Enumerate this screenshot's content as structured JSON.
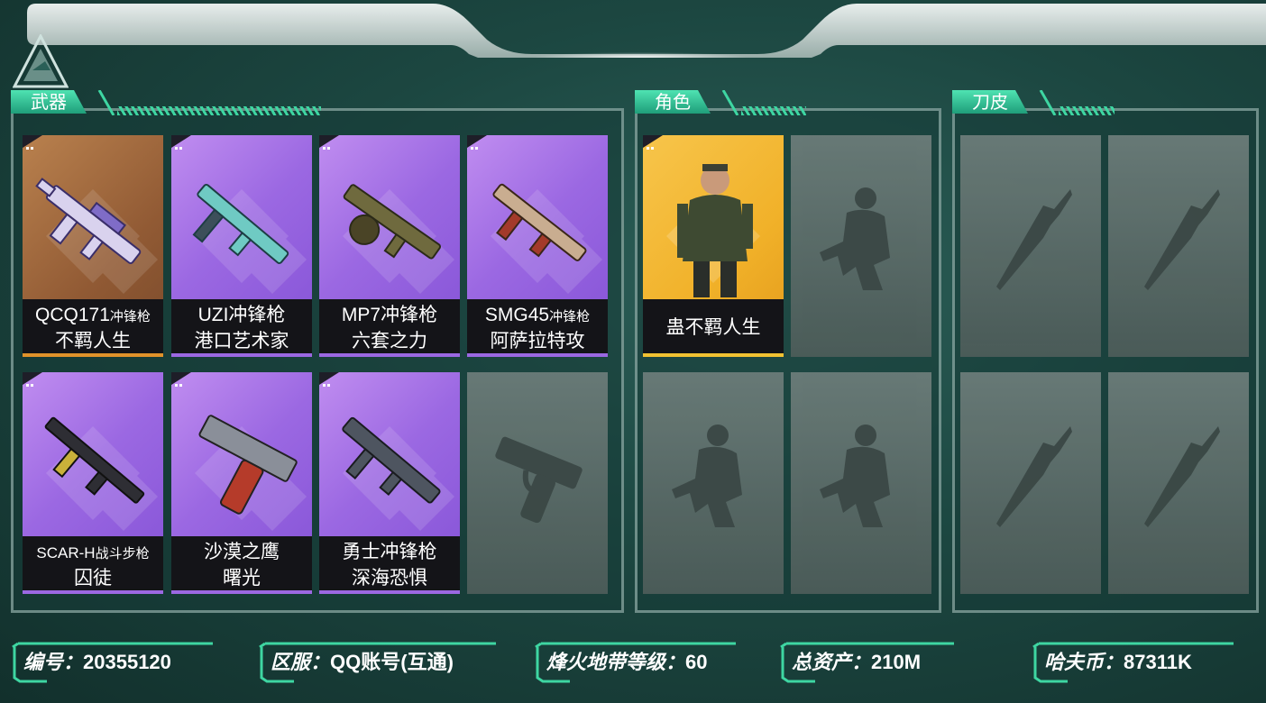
{
  "sections": {
    "weapons": "武器",
    "characters": "角色",
    "knives": "刀皮"
  },
  "weapons": [
    {
      "name": "QCQ171",
      "type": "冲锋枪",
      "skin": "不羁人生",
      "rarity": "orange"
    },
    {
      "name": "UZI冲锋枪",
      "type": "",
      "skin": "港口艺术家",
      "rarity": "purple"
    },
    {
      "name": "MP7冲锋枪",
      "type": "",
      "skin": "六套之力",
      "rarity": "purple"
    },
    {
      "name": "SMG45",
      "type": "冲锋枪",
      "skin": "阿萨拉特攻",
      "rarity": "purple"
    },
    {
      "name": "SCAR-H",
      "type": "战斗步枪",
      "skin": "囚徒",
      "rarity": "purple"
    },
    {
      "name": "沙漠之鹰",
      "type": "",
      "skin": "曙光",
      "rarity": "purple"
    },
    {
      "name": "勇士冲锋枪",
      "type": "",
      "skin": "深海恐惧",
      "rarity": "purple"
    }
  ],
  "characters": [
    {
      "skin": "蛊不羁人生",
      "rarity": "gold"
    }
  ],
  "footer": {
    "id_label": "编号：",
    "id_value": "20355120",
    "server_label": "区服：",
    "server_value": "QQ账号(互通)",
    "level_label": "烽火地带等级：",
    "level_value": "60",
    "assets_label": "总资产：",
    "assets_value": "210M",
    "coins_label": "哈夫币：",
    "coins_value": "87311K"
  },
  "colors": {
    "accent": "#3ed6a2",
    "purple": "#9b68e2",
    "orange": "#e0922a",
    "gold": "#f1c232"
  }
}
